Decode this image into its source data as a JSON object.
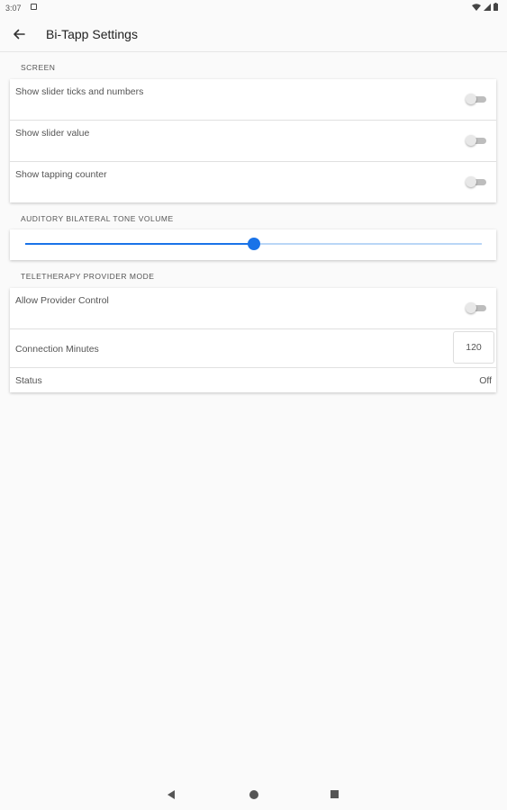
{
  "status_bar": {
    "time": "3:07"
  },
  "app_bar": {
    "title": "Bi-Tapp Settings"
  },
  "sections": {
    "screen": {
      "header": "SCREEN",
      "items": [
        {
          "label": "Show slider ticks and numbers",
          "on": false
        },
        {
          "label": "Show slider value",
          "on": false
        },
        {
          "label": "Show tapping counter",
          "on": false
        }
      ]
    },
    "volume": {
      "header": "AUDITORY BILATERAL TONE VOLUME",
      "value_fraction": 0.5
    },
    "teletherapy": {
      "header": "TELETHERAPY PROVIDER MODE",
      "allow_control": {
        "label": "Allow Provider Control",
        "on": false
      },
      "connection_minutes": {
        "label": "Connection Minutes",
        "value": "120"
      },
      "status": {
        "label": "Status",
        "value": "Off"
      }
    }
  },
  "colors": {
    "accent": "#1a73e8",
    "accent_light": "#b9d6f6"
  }
}
